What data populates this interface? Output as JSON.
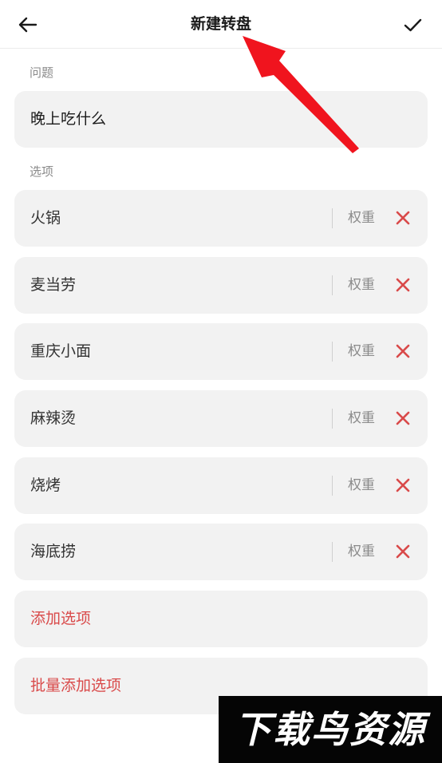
{
  "header": {
    "title": "新建转盘",
    "back_icon": "arrow-left-icon",
    "confirm_icon": "check-icon"
  },
  "question": {
    "section_label": "问题",
    "value": "晚上吃什么"
  },
  "options": {
    "section_label": "选项",
    "weight_label": "权重",
    "remove_icon": "close-icon",
    "items": [
      {
        "label": "火锅"
      },
      {
        "label": "麦当劳"
      },
      {
        "label": "重庆小面"
      },
      {
        "label": "麻辣烫"
      },
      {
        "label": "烧烤"
      },
      {
        "label": "海底捞"
      }
    ]
  },
  "actions": {
    "add_option": "添加选项",
    "batch_add": "批量添加选项"
  },
  "watermark": {
    "text": "下载鸟资源"
  },
  "colors": {
    "accent_red": "#d94a4a",
    "card_bg": "#f2f2f2",
    "annotation_arrow": "#f0141e"
  }
}
